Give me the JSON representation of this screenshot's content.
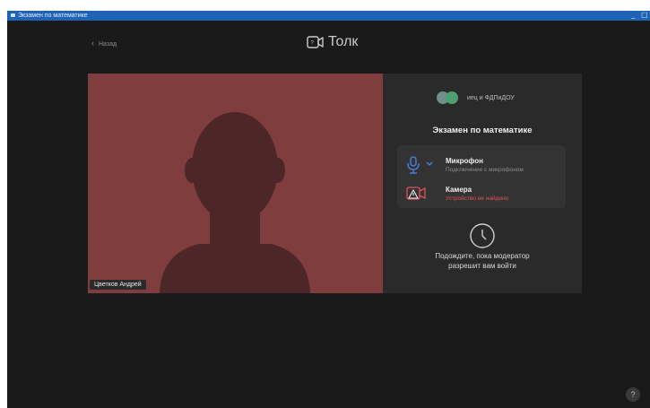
{
  "window": {
    "title": "Экзамен по математике",
    "minimize_glyph": "_",
    "maximize_glyph": "▢"
  },
  "header": {
    "back_label": "Назад",
    "logo_text": "Толк"
  },
  "video": {
    "participant_name": "Цветков Андрей",
    "background_color": "#7f3d3e"
  },
  "panel": {
    "organization": "иец и ФДПиДОУ",
    "exam_title": "Экзамен по математике",
    "devices": [
      {
        "name": "Микрофон",
        "status": "Подключение с микрофоном",
        "icon": "microphone-icon",
        "status_color": "#8c8c8c"
      },
      {
        "name": "Камера",
        "status": "Устройство не найдено",
        "icon": "camera-warning-icon",
        "status_color": "#e0525a"
      }
    ],
    "wait_line1": "Подождите, пока модератор",
    "wait_line2": "разрешит вам войти"
  },
  "help_label": "?",
  "colors": {
    "titlebar": "#1f63b4",
    "background": "#1a1a1a",
    "panel": "#2a2a2a",
    "accent_blue": "#4a86e8",
    "error_red": "#e0525a"
  }
}
